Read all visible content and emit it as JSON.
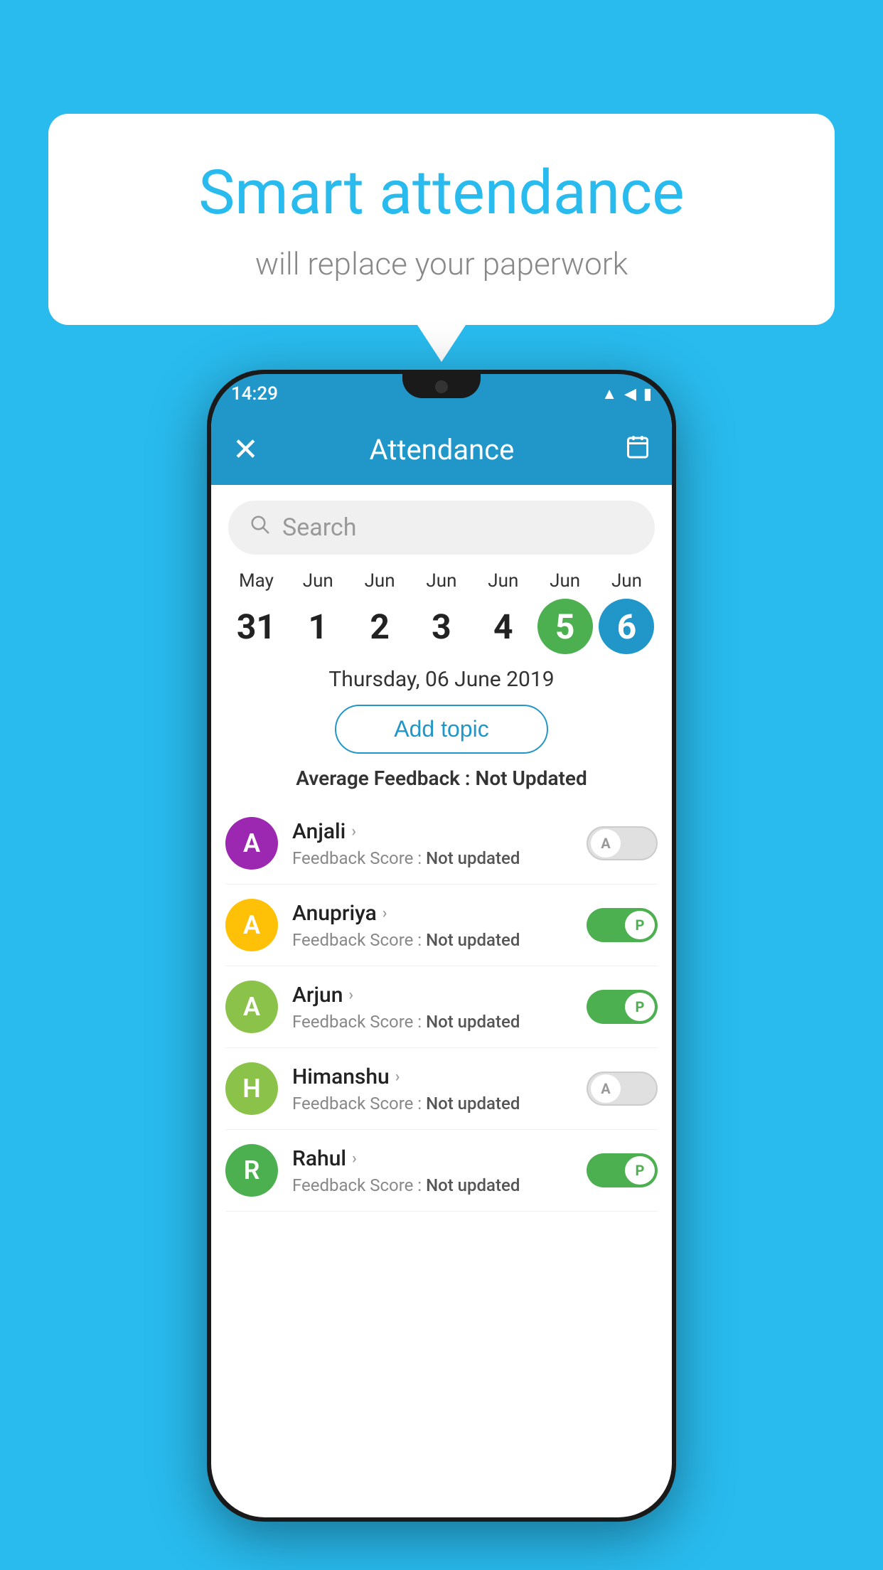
{
  "background_color": "#29BBEE",
  "speech_bubble": {
    "title": "Smart attendance",
    "subtitle": "will replace your paperwork"
  },
  "status_bar": {
    "time": "14:29",
    "wifi_icon": "wifi-icon",
    "signal_icon": "signal-icon",
    "battery_icon": "battery-icon"
  },
  "header": {
    "close_label": "✕",
    "title": "Attendance",
    "calendar_icon": "📅"
  },
  "search": {
    "placeholder": "Search"
  },
  "calendar": {
    "items": [
      {
        "month": "May",
        "day": "31",
        "state": "normal"
      },
      {
        "month": "Jun",
        "day": "1",
        "state": "normal"
      },
      {
        "month": "Jun",
        "day": "2",
        "state": "normal"
      },
      {
        "month": "Jun",
        "day": "3",
        "state": "normal"
      },
      {
        "month": "Jun",
        "day": "4",
        "state": "normal"
      },
      {
        "month": "Jun",
        "day": "5",
        "state": "today"
      },
      {
        "month": "Jun",
        "day": "6",
        "state": "selected"
      }
    ]
  },
  "date_display": "Thursday, 06 June 2019",
  "add_topic_label": "Add topic",
  "avg_feedback": {
    "label": "Average Feedback : ",
    "value": "Not Updated"
  },
  "students": [
    {
      "name": "Anjali",
      "initial": "A",
      "avatar_color": "#9C27B0",
      "feedback_label": "Feedback Score : ",
      "feedback_value": "Not updated",
      "attendance": "absent",
      "toggle_label": "A"
    },
    {
      "name": "Anupriya",
      "initial": "A",
      "avatar_color": "#FFC107",
      "feedback_label": "Feedback Score : ",
      "feedback_value": "Not updated",
      "attendance": "present",
      "toggle_label": "P"
    },
    {
      "name": "Arjun",
      "initial": "A",
      "avatar_color": "#8BC34A",
      "feedback_label": "Feedback Score : ",
      "feedback_value": "Not updated",
      "attendance": "present",
      "toggle_label": "P"
    },
    {
      "name": "Himanshu",
      "initial": "H",
      "avatar_color": "#8BC34A",
      "feedback_label": "Feedback Score : ",
      "feedback_value": "Not updated",
      "attendance": "absent",
      "toggle_label": "A"
    },
    {
      "name": "Rahul",
      "initial": "R",
      "avatar_color": "#4CAF50",
      "feedback_label": "Feedback Score : ",
      "feedback_value": "Not updated",
      "attendance": "present",
      "toggle_label": "P"
    }
  ]
}
